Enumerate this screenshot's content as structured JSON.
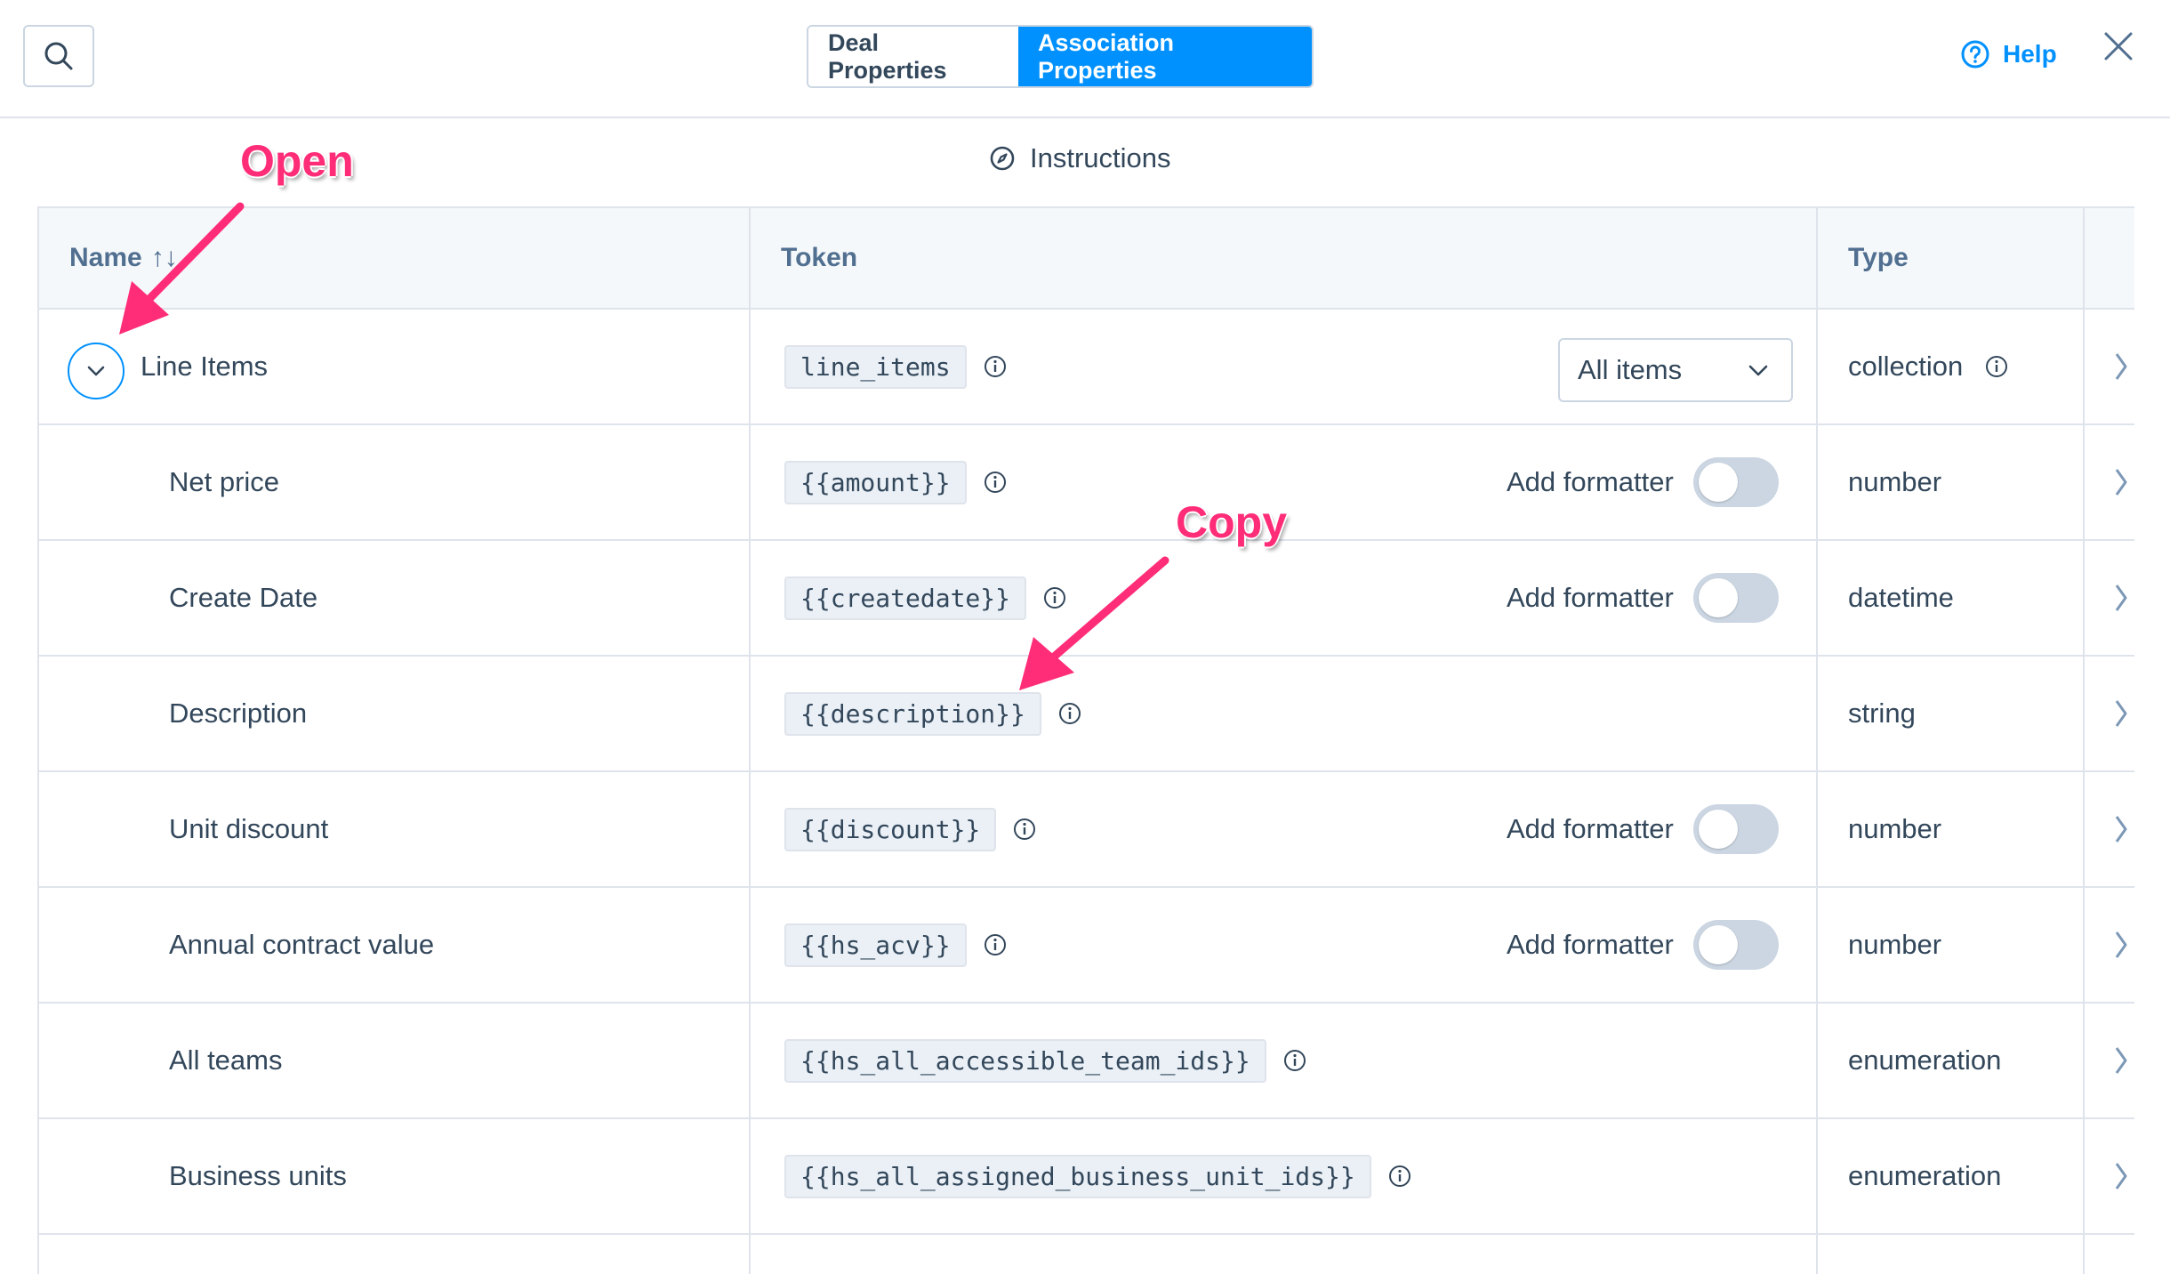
{
  "tabs": {
    "deal": "Deal Properties",
    "association": "Association Properties"
  },
  "help_label": "Help",
  "instructions_label": "Instructions",
  "columns": {
    "name": "Name",
    "token": "Token",
    "type": "Type"
  },
  "sort_icon": "↑↓",
  "parent_row": {
    "name": "Line Items",
    "token": "line_items",
    "select_value": "All items",
    "type": "collection"
  },
  "rows": [
    {
      "name": "Net price",
      "token": "{{amount}}",
      "formatter": "Add formatter",
      "type": "number"
    },
    {
      "name": "Create Date",
      "token": "{{createdate}}",
      "formatter": "Add formatter",
      "type": "datetime"
    },
    {
      "name": "Description",
      "token": "{{description}}",
      "formatter": "",
      "type": "string"
    },
    {
      "name": "Unit discount",
      "token": "{{discount}}",
      "formatter": "Add formatter",
      "type": "number"
    },
    {
      "name": "Annual contract value",
      "token": "{{hs_acv}}",
      "formatter": "Add formatter",
      "type": "number"
    },
    {
      "name": "All teams",
      "token": "{{hs_all_accessible_team_ids}}",
      "formatter": "",
      "type": "enumeration"
    },
    {
      "name": "Business units",
      "token": "{{hs_all_assigned_business_unit_ids}}",
      "formatter": "",
      "type": "enumeration"
    }
  ],
  "annotations": {
    "open": "Open",
    "copy": "Copy"
  },
  "colors": {
    "accent": "#0091ff",
    "annotation": "#ff2d78",
    "header_bg": "#f5f8fa"
  }
}
